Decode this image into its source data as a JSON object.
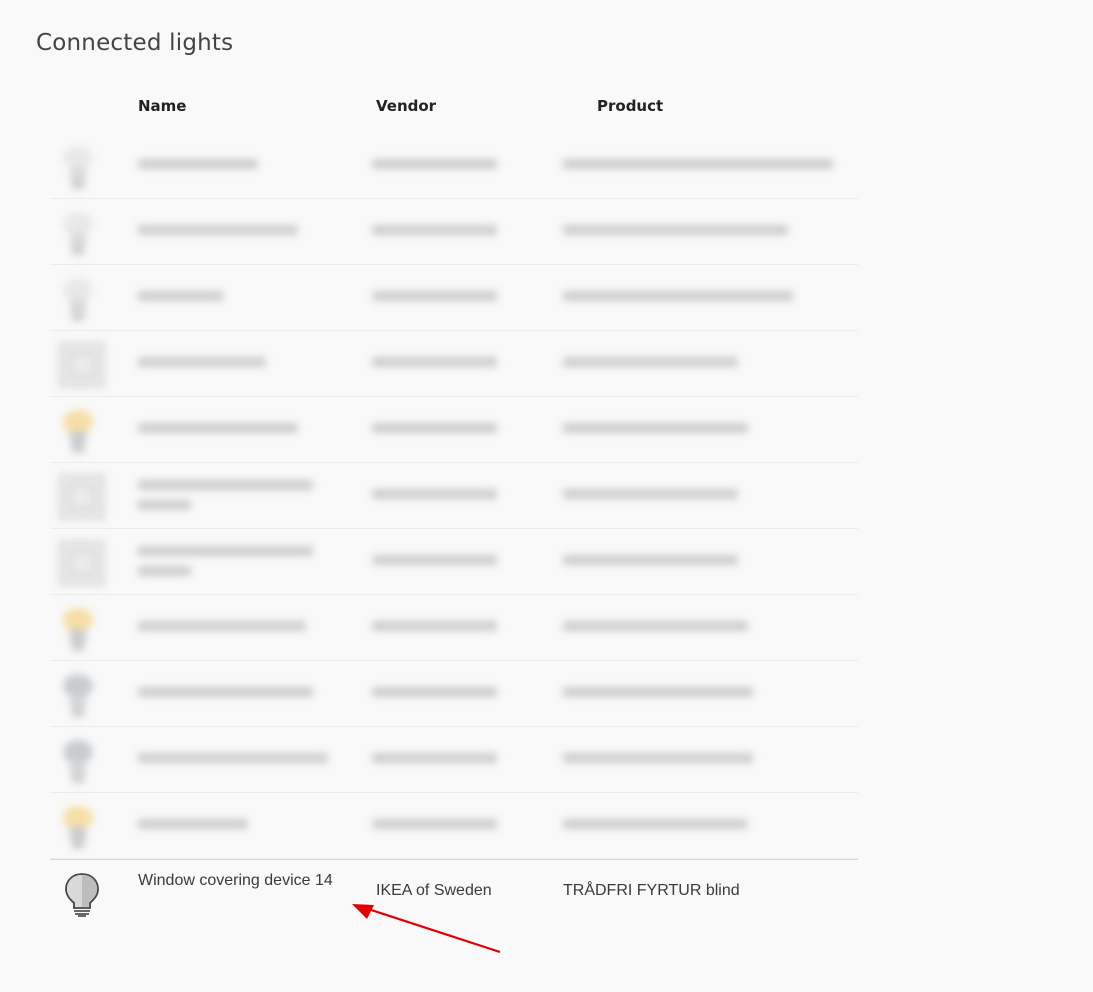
{
  "page": {
    "title": "Connected lights"
  },
  "columns": {
    "name": "Name",
    "vendor": "Vendor",
    "product": "Product"
  },
  "blurred_rows": [
    {
      "icon": "bulb-icon",
      "tone": "grey",
      "lines": 1
    },
    {
      "icon": "bulb-icon",
      "tone": "grey",
      "lines": 1
    },
    {
      "icon": "bulb-icon",
      "tone": "grey",
      "lines": 1
    },
    {
      "icon": "plug-icon",
      "tone": "grey",
      "lines": 1
    },
    {
      "icon": "bulb-icon",
      "tone": "warm",
      "lines": 1
    },
    {
      "icon": "plug-icon",
      "tone": "grey",
      "lines": 2
    },
    {
      "icon": "plug-icon",
      "tone": "grey",
      "lines": 2
    },
    {
      "icon": "bulb-icon",
      "tone": "warm",
      "lines": 1
    },
    {
      "icon": "bulb-icon",
      "tone": "cool",
      "lines": 1
    },
    {
      "icon": "bulb-icon",
      "tone": "cool",
      "lines": 1
    },
    {
      "icon": "bulb-icon",
      "tone": "warm",
      "lines": 1
    }
  ],
  "highlighted_row": {
    "name": "Window covering device 14",
    "vendor": "IKEA of Sweden",
    "product": "TRÅDFRI FYRTUR blind",
    "icon": "bulb-icon"
  },
  "colors": {
    "arrow": "#e00000",
    "warm_bulb": "#f5d58a",
    "cool_bulb": "#b8bcc0"
  }
}
